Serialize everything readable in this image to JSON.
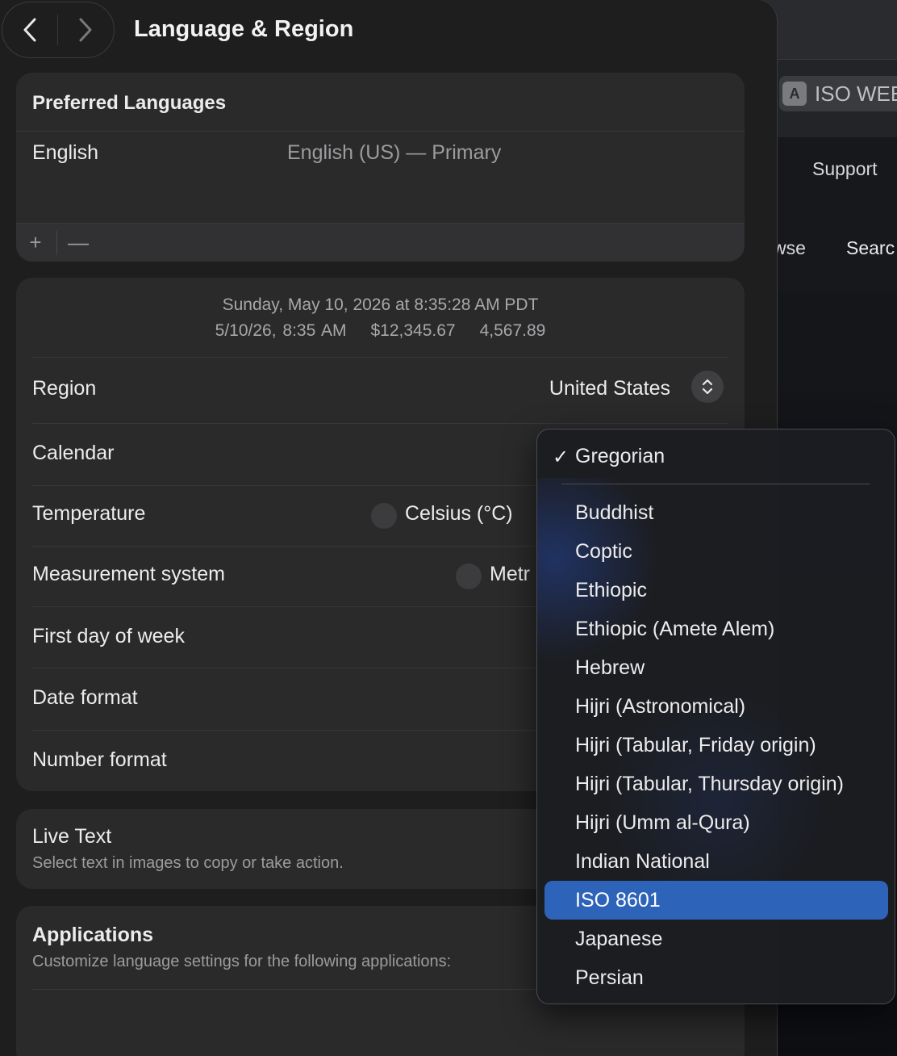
{
  "background_window": {
    "field_badge": "A",
    "field_text": "ISO WEE",
    "nav_support": "Support",
    "nav_browse_partial": "wse",
    "nav_search_partial": "Searc"
  },
  "window": {
    "title": "Language & Region",
    "back_icon": "chevron-left-icon",
    "forward_icon": "chevron-right-icon"
  },
  "preferred_languages": {
    "header": "Preferred Languages",
    "items": [
      {
        "name": "English",
        "detail": "English (US) — Primary"
      }
    ],
    "add_label": "+",
    "remove_label": "—"
  },
  "preview": {
    "date_long": "Sunday, May 10, 2026 at 8:35:28 AM PDT",
    "date_short": "5/10/26, 8:35 AM",
    "currency": "$12,345.67",
    "number": "4,567.89"
  },
  "region": {
    "label": "Region",
    "value": "United States",
    "stepper_icon": "chevron-up-down-icon"
  },
  "calendar": {
    "label": "Calendar"
  },
  "temperature": {
    "label": "Temperature",
    "option": "Celsius (°C)"
  },
  "measurement": {
    "label": "Measurement system",
    "option_partial": "Metr"
  },
  "first_day": {
    "label": "First day of week"
  },
  "date_format": {
    "label": "Date format"
  },
  "number_format": {
    "label": "Number format"
  },
  "live_text": {
    "title": "Live Text",
    "subtitle": "Select text in images to copy or take action."
  },
  "applications": {
    "title": "Applications",
    "subtitle": "Customize language settings for the following applications:"
  },
  "calendar_menu": {
    "checked": "Gregorian",
    "checkmark": "✓",
    "items": [
      "Buddhist",
      "Coptic",
      "Ethiopic",
      "Ethiopic (Amete Alem)",
      "Hebrew",
      "Hijri (Astronomical)",
      "Hijri (Tabular, Friday origin)",
      "Hijri (Tabular, Thursday origin)",
      "Hijri (Umm al-Qura)",
      "Indian National",
      "ISO 8601",
      "Japanese",
      "Persian"
    ],
    "highlighted": "ISO 8601",
    "highlight_color": "#2d63b8"
  }
}
